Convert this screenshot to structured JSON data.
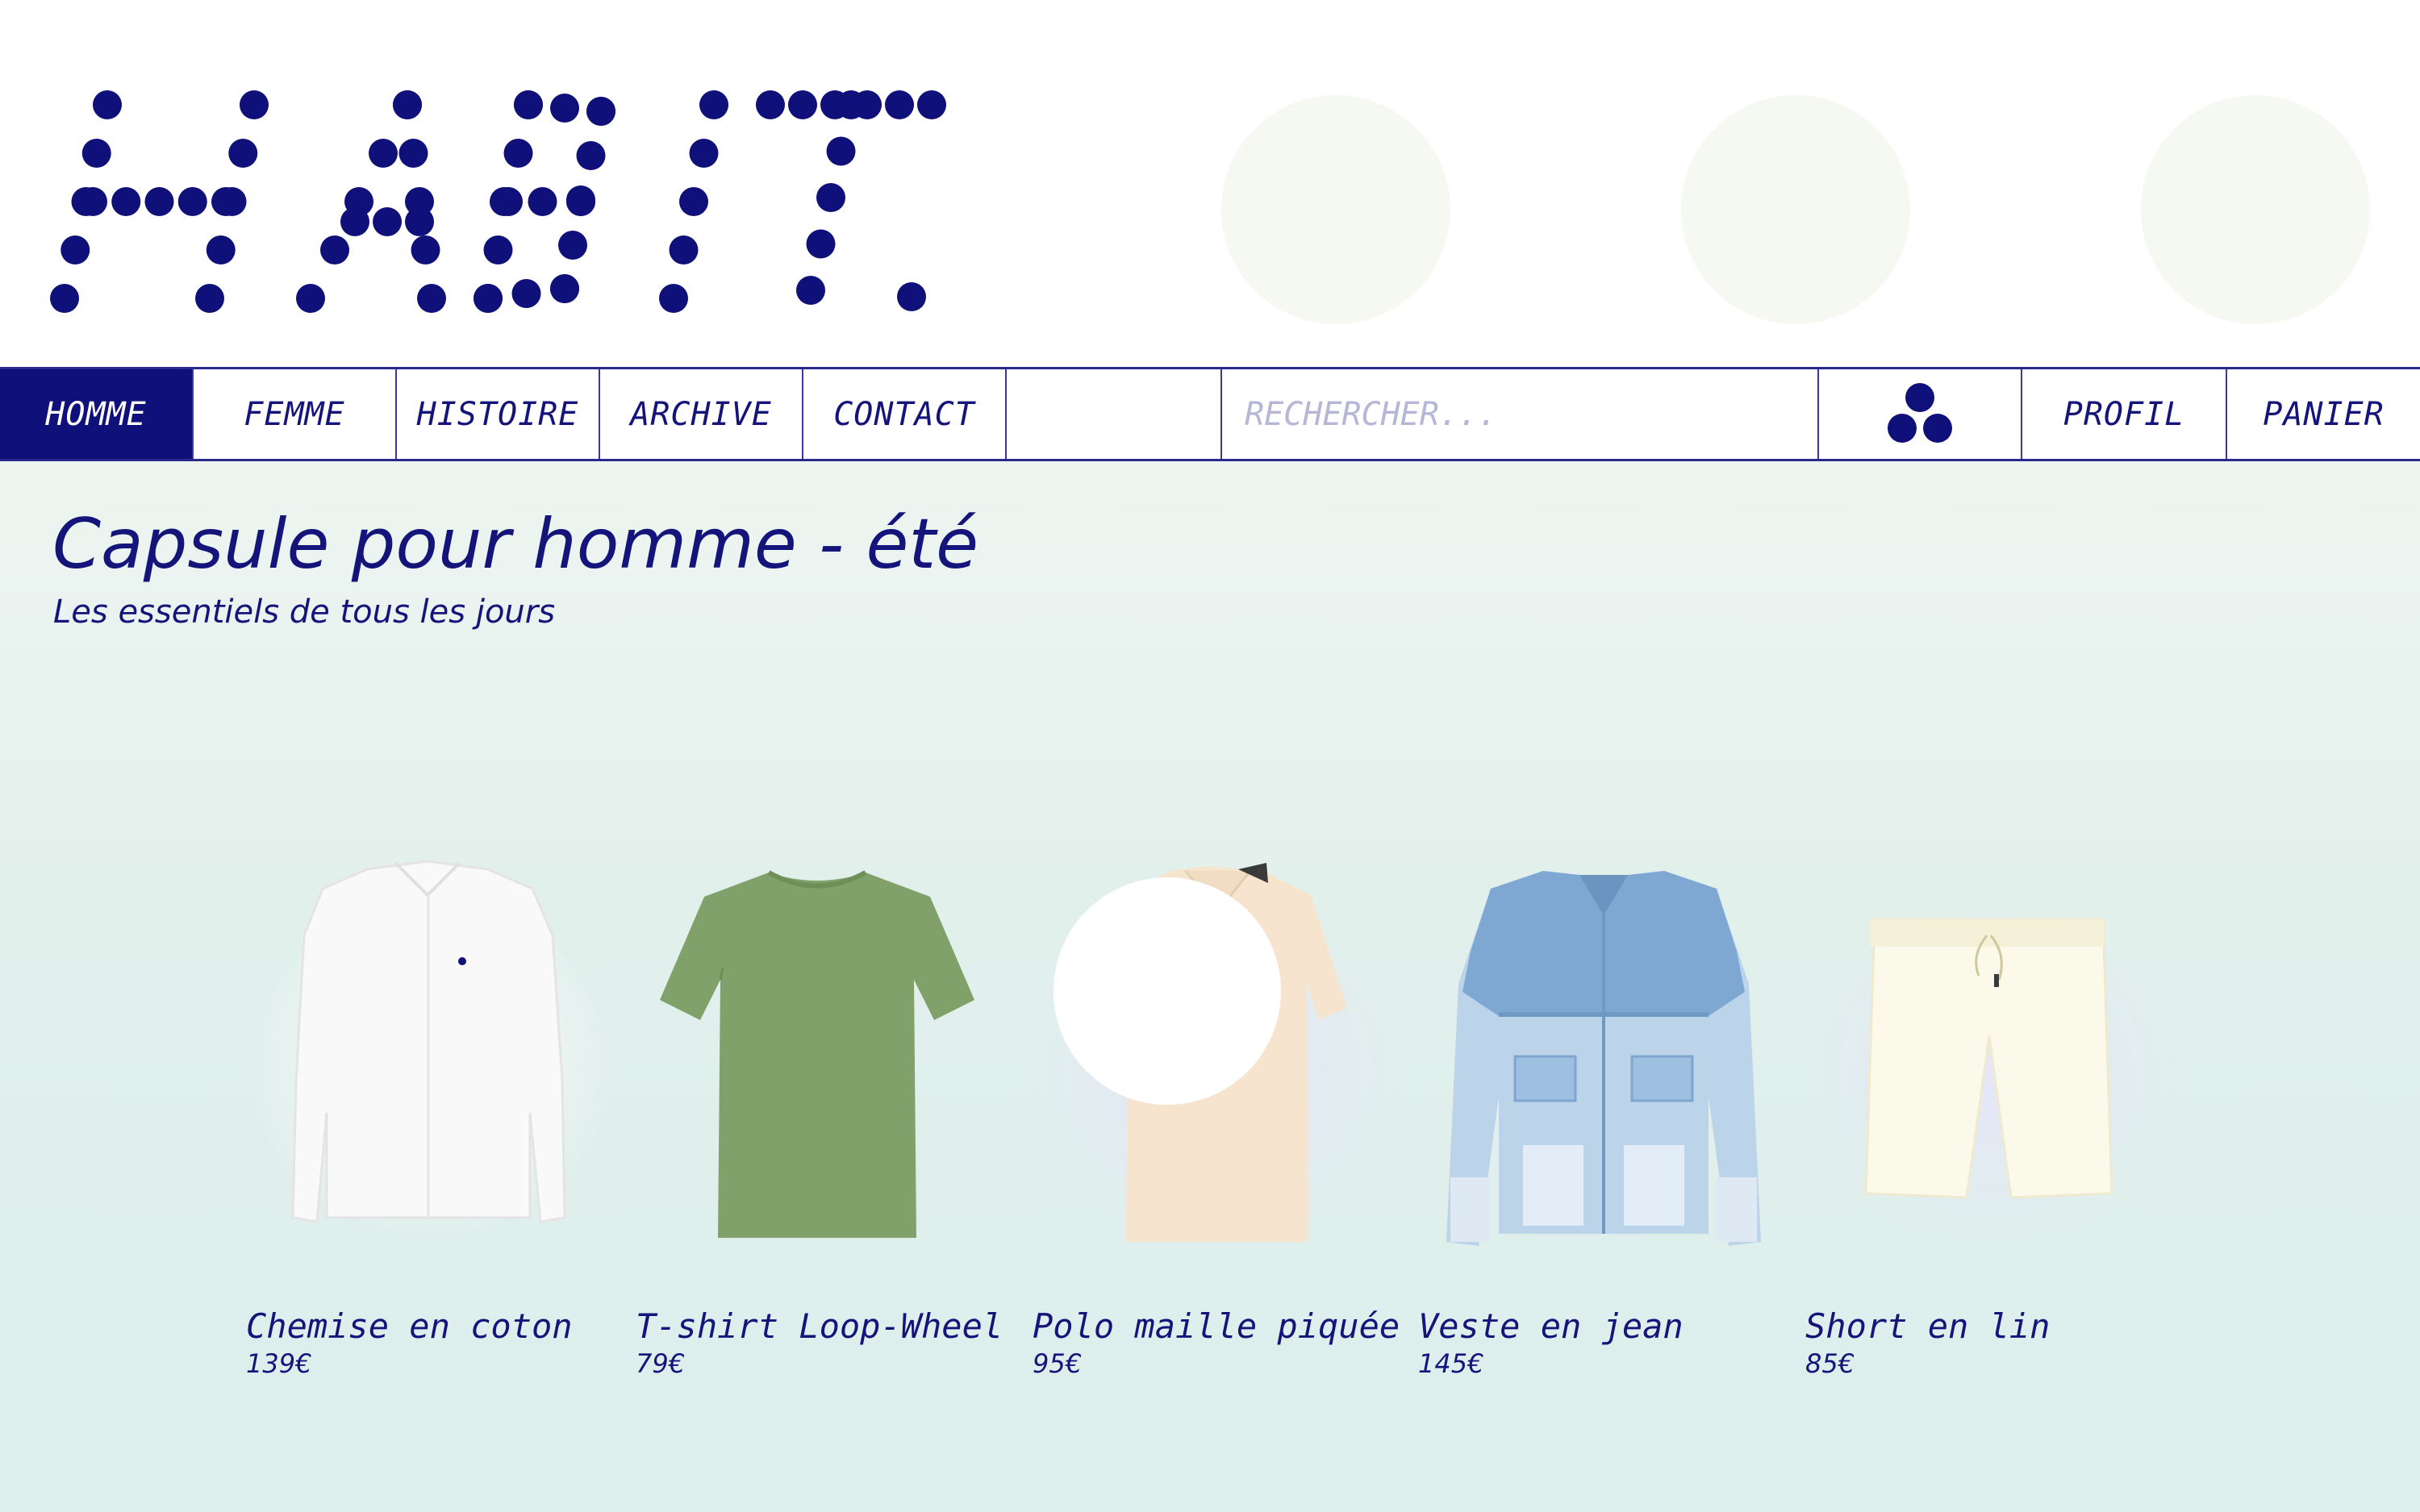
{
  "brand": {
    "logo_text": "HABIT."
  },
  "nav": {
    "items": [
      {
        "label": "HOMME",
        "active": true
      },
      {
        "label": "FEMME",
        "active": false
      },
      {
        "label": "HISTOIRE",
        "active": false
      },
      {
        "label": "ARCHIVE",
        "active": false
      },
      {
        "label": "CONTACT",
        "active": false
      }
    ],
    "search_placeholder": "RECHERCHER...",
    "profile_label": "PROFIL",
    "cart_label": "PANIER",
    "icon": "three-dots-logo-icon"
  },
  "main": {
    "title": "Capsule pour homme - été",
    "subtitle": "Les essentiels de tous les jours"
  },
  "products": [
    {
      "name": "Chemise en coton",
      "price": "139€",
      "icon": "white-shirt-image"
    },
    {
      "name": "T-shirt Loop-Wheel",
      "price": "79€",
      "icon": "green-tshirt-image"
    },
    {
      "name": "Polo maille piquée",
      "price": "95€",
      "icon": "beige-polo-image"
    },
    {
      "name": "Veste en jean",
      "price": "145€",
      "icon": "denim-jacket-image"
    },
    {
      "name": "Short en lin",
      "price": "85€",
      "icon": "linen-shorts-image"
    }
  ],
  "colors": {
    "accent": "#10107a",
    "background_top": "#ffffff",
    "background_bottom": "#ddeeed",
    "decor_circle": "#f6f8f2"
  }
}
